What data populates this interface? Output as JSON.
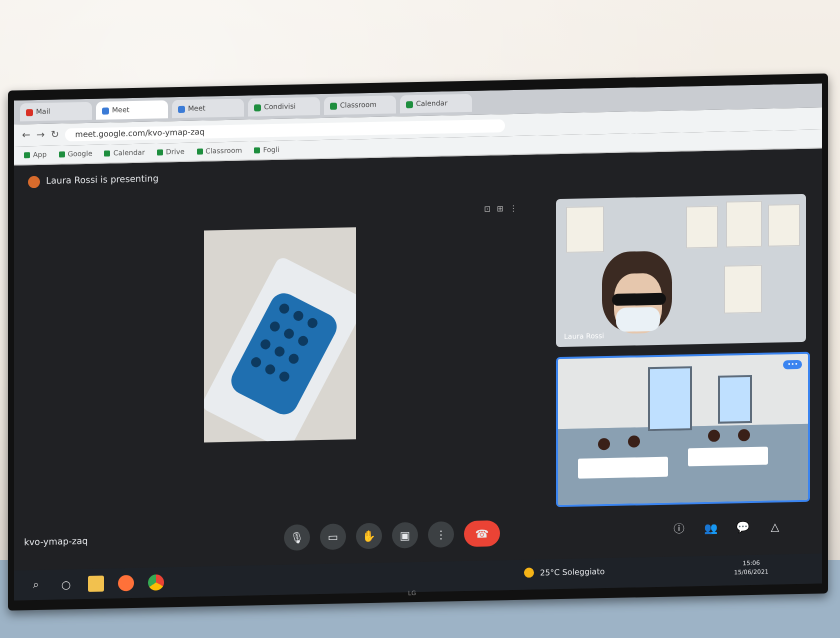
{
  "browser": {
    "tabs": [
      {
        "label": "Mail",
        "kind": "r"
      },
      {
        "label": "Meet",
        "kind": "b"
      },
      {
        "label": "Meet",
        "kind": "b"
      },
      {
        "label": "Condivisi",
        "kind": "g"
      },
      {
        "label": "Classroom",
        "kind": "g"
      },
      {
        "label": "Calendar",
        "kind": "g"
      }
    ],
    "url": "meet.google.com/kvo-ymap-zaq",
    "bookmarks": [
      "App",
      "Google",
      "Calendar",
      "Drive",
      "Classroom",
      "Fogli"
    ]
  },
  "meet": {
    "presenting_text": "Laura Rossi is presenting",
    "participant_name": "Laura Rossi",
    "meeting_code": "kvo-ymap-zaq",
    "controls": [
      "mic",
      "camera",
      "hand",
      "present",
      "more",
      "hangup"
    ],
    "right_controls": [
      "info",
      "people",
      "chat",
      "activities"
    ]
  },
  "taskbar": {
    "icons": [
      "search-icon",
      "taskview-icon",
      "folder-icon",
      "firefox-icon",
      "chrome-icon"
    ],
    "weather": "25°C Soleggiato",
    "time": "15:06",
    "date": "15/06/2021"
  },
  "tv": {
    "brand": "LG"
  }
}
